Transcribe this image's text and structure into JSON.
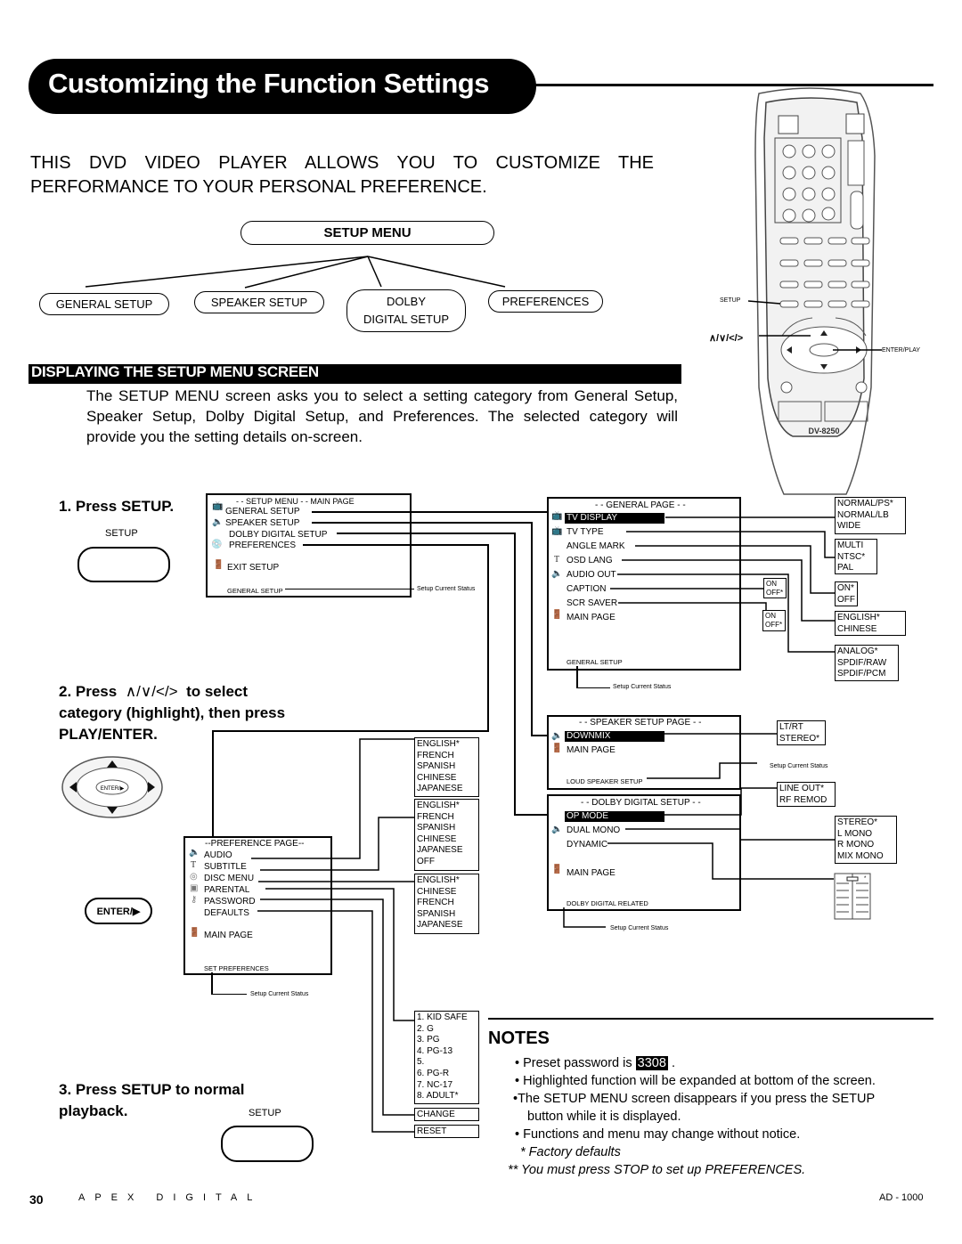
{
  "header": {
    "title": "Customizing the Function Settings",
    "intro_line1": "THIS DVD VIDEO PLAYER ALLOWS YOU TO CUSTOMIZE THE",
    "intro_line2": "PERFORMANCE TO YOUR PERSONAL PREFERENCE."
  },
  "tree": {
    "root": "SETUP MENU",
    "children": [
      "GENERAL SETUP",
      "SPEAKER SETUP",
      "DOLBY",
      "DIGITAL SETUP",
      "PREFERENCES"
    ]
  },
  "remote": {
    "setup_label": "SETUP",
    "arrows_label": "∧/∨/</>",
    "enter_label": "ENTER/PLAY",
    "model": "DV-8250"
  },
  "section": {
    "title": "DISPLAYING THE SETUP MENU SCREEN",
    "body": "The SETUP MENU screen asks you to select a setting category from General Setup, Speaker Setup, Dolby Digital Setup, and Preferences.  The selected category will provide you the setting details on-screen."
  },
  "steps": {
    "step1": "1. Press SETUP.",
    "step1_button": "SETUP",
    "step2_a": "2. Press",
    "step2_arrows": "∧/∨/</>",
    "step2_b": "to select",
    "step2_line2": "category (highlight), then press",
    "step2_line3": "PLAY/ENTER.",
    "enter_button": "ENTER/▶",
    "step3_line1": "3. Press SETUP to normal",
    "step3_line2": "playback.",
    "step3_button": "SETUP"
  },
  "main_page": {
    "title": "- - SETUP MENU  - -  MAIN PAGE",
    "items": [
      "GENERAL SETUP",
      "SPEAKER SETUP",
      "DOLBY DIGITAL SETUP",
      "PREFERENCES",
      "EXIT SETUP"
    ],
    "status": "GENERAL SETUP",
    "status_caption": "Setup Current Status"
  },
  "general_page": {
    "title": "- - GENERAL PAGE - -",
    "items": [
      "TV DISPLAY",
      "TV TYPE",
      "ANGLE MARK",
      "OSD LANG",
      "AUDIO OUT",
      "CAPTION",
      "SCR SAVER",
      "MAIN PAGE"
    ],
    "status": "GENERAL SETUP",
    "status_caption": "Setup Current Status",
    "options": {
      "tv_display": [
        "NORMAL/PS*",
        "NORMAL/LB",
        "WIDE"
      ],
      "tv_type": [
        "MULTI",
        "NTSC*",
        "PAL"
      ],
      "angle_mark": [
        "ON*",
        "OFF"
      ],
      "osd_lang": [
        "ENGLISH*",
        "CHINESE"
      ],
      "audio_out": [
        "ANALOG*",
        "SPDIF/RAW",
        "SPDIF/PCM"
      ],
      "caption": [
        "ON",
        "OFF*"
      ],
      "scr_saver": [
        "ON",
        "OFF*"
      ]
    }
  },
  "speaker_page": {
    "title": "- - SPEAKER SETUP PAGE - -",
    "items": [
      "DOWNMIX",
      "MAIN PAGE"
    ],
    "status": "LOUD SPEAKER SETUP",
    "status_caption": "Setup Current Status",
    "options": {
      "downmix": [
        "LT/RT",
        "STEREO*"
      ]
    }
  },
  "dolby_page": {
    "title": "- - DOLBY DIGITAL SETUP - -",
    "items": [
      "OP MODE",
      "DUAL MONO",
      "DYNAMIC",
      "MAIN PAGE"
    ],
    "status": "DOLBY DIGITAL RELATED",
    "status_caption": "Setup Current Status",
    "options": {
      "op_mode": [
        "LINE OUT*",
        "RF REMOD"
      ],
      "dual_mono": [
        "STEREO*",
        "L MONO",
        "R MONO",
        "MIX MONO"
      ],
      "dynamic_marker": "*"
    }
  },
  "preference_page": {
    "title": "--PREFERENCE PAGE--",
    "items": [
      "AUDIO",
      "SUBTITLE",
      "DISC MENU",
      "PARENTAL",
      "PASSWORD",
      "DEFAULTS",
      "MAIN PAGE"
    ],
    "status": "SET PREFERENCES",
    "status_caption": "Setup Current Status",
    "options": {
      "audio": [
        "ENGLISH*",
        "FRENCH",
        "SPANISH",
        "CHINESE",
        "JAPANESE"
      ],
      "subtitle": [
        "ENGLISH*",
        "FRENCH",
        "SPANISH",
        "CHINESE",
        "JAPANESE",
        "OFF"
      ],
      "disc_menu": [
        "ENGLISH*",
        "CHINESE",
        "FRENCH",
        "SPANISH",
        "JAPANESE"
      ],
      "parental": [
        "1. KID SAFE",
        "2. G",
        "3. PG",
        "4. PG-13",
        "5.",
        "6. PG-R",
        "7. NC-17",
        "8. ADULT*"
      ],
      "password": [
        "CHANGE"
      ],
      "defaults": [
        "RESET"
      ]
    }
  },
  "notes": {
    "title": "NOTES",
    "password_prefix": "• Preset password is",
    "password": "3308",
    "password_suffix": ".",
    "item2": "• Highlighted function will be expanded at bottom of the screen.",
    "item3a": "•The SETUP MENU screen disappears if you press the SETUP",
    "item3b": "button while it is displayed.",
    "item4": "• Functions and menu may change without notice.",
    "footnote1": "* Factory defaults",
    "footnote2": "** You must press STOP to set up PREFERENCES."
  },
  "footer": {
    "page_number": "30",
    "brand": "APEX DIGITAL",
    "model": "AD - 1000"
  }
}
